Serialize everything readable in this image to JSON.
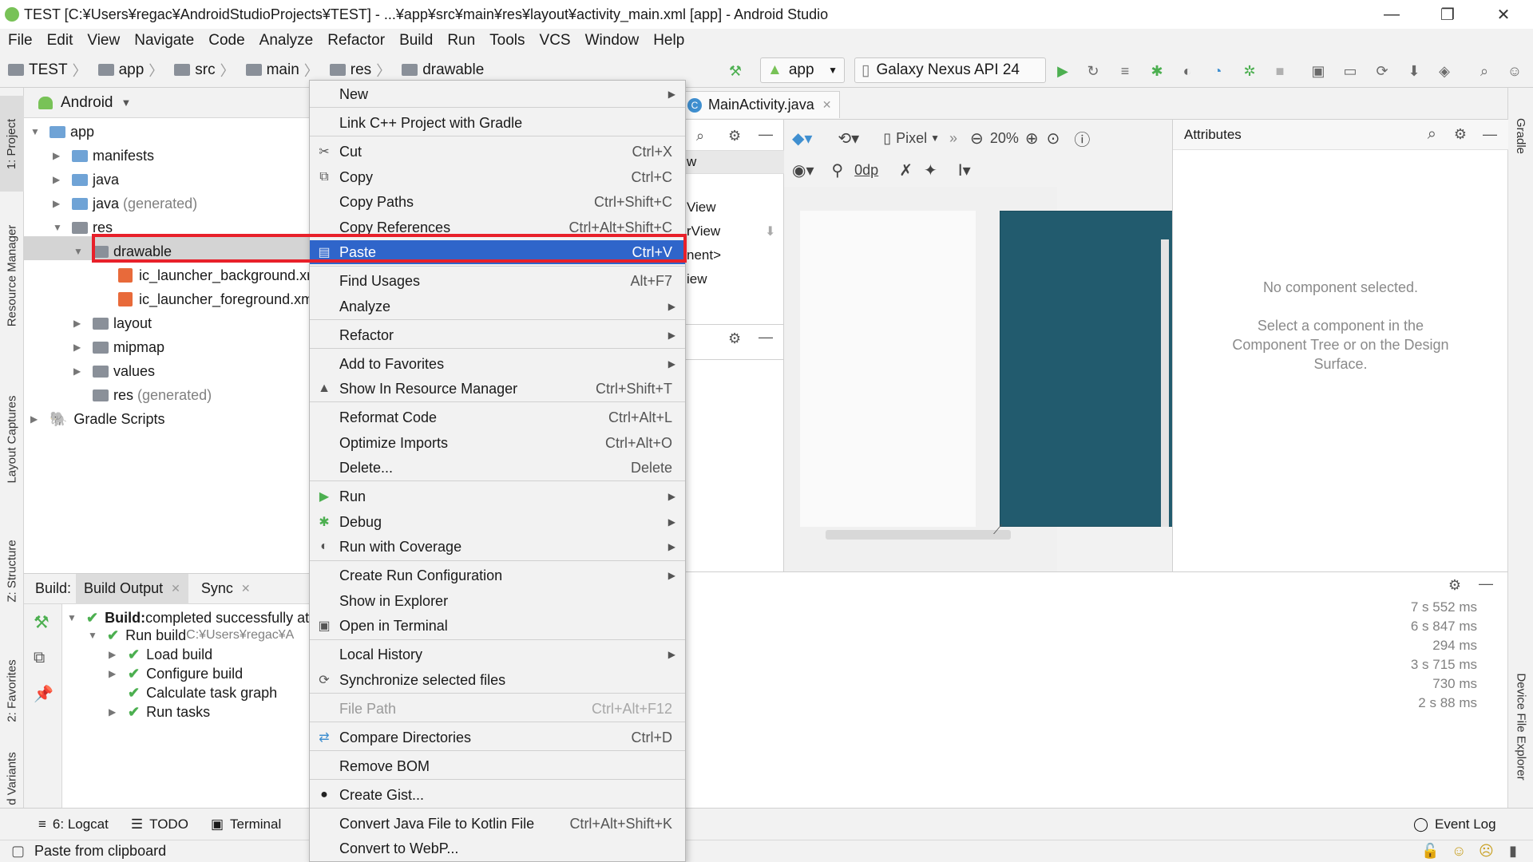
{
  "window": {
    "title": "TEST [C:¥Users¥regac¥AndroidStudioProjects¥TEST] - ...¥app¥src¥main¥res¥layout¥activity_main.xml [app] - Android Studio",
    "minimize": "—",
    "restore": "❐",
    "close": "✕"
  },
  "menubar": [
    "File",
    "Edit",
    "View",
    "Navigate",
    "Code",
    "Analyze",
    "Refactor",
    "Build",
    "Run",
    "Tools",
    "VCS",
    "Window",
    "Help"
  ],
  "breadcrumb": [
    "TEST",
    "app",
    "src",
    "main",
    "res",
    "drawable"
  ],
  "toolbar": {
    "config": "app",
    "device": "Galaxy Nexus API 24"
  },
  "left_stripe": [
    "1: Project",
    "Resource Manager",
    "Layout Captures",
    "Z: Structure",
    "2: Favorites",
    "d Variants"
  ],
  "right_stripe": [
    "Gradle",
    "Device File Explorer"
  ],
  "project": {
    "view": "Android",
    "tree": [
      {
        "label": "app",
        "extra": ""
      },
      {
        "label": "manifests",
        "extra": ""
      },
      {
        "label": "java",
        "extra": ""
      },
      {
        "label": "java",
        "extra": "(generated)"
      },
      {
        "label": "res",
        "extra": ""
      },
      {
        "label": "drawable",
        "extra": ""
      },
      {
        "label": "ic_launcher_background.xml",
        "extra": ""
      },
      {
        "label": "ic_launcher_foreground.xml",
        "extra": ""
      },
      {
        "label": "layout",
        "extra": ""
      },
      {
        "label": "mipmap",
        "extra": ""
      },
      {
        "label": "values",
        "extra": ""
      },
      {
        "label": "res",
        "extra": "(generated)"
      },
      {
        "label": "Gradle Scripts",
        "extra": ""
      }
    ]
  },
  "build": {
    "label": "Build:",
    "tabs": [
      "Build Output",
      "Sync"
    ],
    "rows": [
      {
        "bold": "Build:",
        "text": " completed successfully at"
      },
      {
        "bold": "",
        "text": "Run build",
        "path": " C:¥Users¥regac¥A"
      },
      {
        "bold": "",
        "text": "Load build"
      },
      {
        "bold": "",
        "text": "Configure build"
      },
      {
        "bold": "",
        "text": "Calculate task graph"
      },
      {
        "bold": "",
        "text": "Run tasks"
      }
    ],
    "times": [
      "7 s 552 ms",
      "6 s 847 ms",
      "294 ms",
      "3 s 715 ms",
      "730 ms",
      "2 s 88 ms"
    ]
  },
  "editor": {
    "tab": "MainActivity.java",
    "device": "Pixel",
    "zoom": "20%",
    "margin": "0dp",
    "palette_items": [
      "w",
      "View",
      "rView",
      "nent>",
      "iew"
    ]
  },
  "attributes": {
    "title": "Attributes",
    "empty_title": "No component selected.",
    "empty_hint": "Select a component in the Component Tree or on the Design Surface."
  },
  "context_menu": [
    {
      "label": "New",
      "shortcut": "",
      "submenu": true,
      "icon": "",
      "state": "normal"
    },
    {
      "label": "Link C++ Project with Gradle",
      "shortcut": "",
      "submenu": false,
      "icon": "",
      "state": "normal"
    },
    {
      "label": "Cut",
      "shortcut": "Ctrl+X",
      "submenu": false,
      "icon": "cut-icon",
      "state": "normal"
    },
    {
      "label": "Copy",
      "shortcut": "Ctrl+C",
      "submenu": false,
      "icon": "copy-icon",
      "state": "normal"
    },
    {
      "label": "Copy Paths",
      "shortcut": "Ctrl+Shift+C",
      "submenu": false,
      "icon": "",
      "state": "normal"
    },
    {
      "label": "Copy References",
      "shortcut": "Ctrl+Alt+Shift+C",
      "submenu": false,
      "icon": "",
      "state": "normal"
    },
    {
      "label": "Paste",
      "shortcut": "Ctrl+V",
      "submenu": false,
      "icon": "paste-icon",
      "state": "highlighted"
    },
    {
      "label": "Find Usages",
      "shortcut": "Alt+F7",
      "submenu": false,
      "icon": "",
      "state": "normal"
    },
    {
      "label": "Analyze",
      "shortcut": "",
      "submenu": true,
      "icon": "",
      "state": "normal"
    },
    {
      "label": "Refactor",
      "shortcut": "",
      "submenu": true,
      "icon": "",
      "state": "normal"
    },
    {
      "label": "Add to Favorites",
      "shortcut": "",
      "submenu": true,
      "icon": "",
      "state": "normal"
    },
    {
      "label": "Show In Resource Manager",
      "shortcut": "Ctrl+Shift+T",
      "submenu": false,
      "icon": "resource-manager-icon",
      "state": "normal"
    },
    {
      "label": "Reformat Code",
      "shortcut": "Ctrl+Alt+L",
      "submenu": false,
      "icon": "",
      "state": "normal"
    },
    {
      "label": "Optimize Imports",
      "shortcut": "Ctrl+Alt+O",
      "submenu": false,
      "icon": "",
      "state": "normal"
    },
    {
      "label": "Delete...",
      "shortcut": "Delete",
      "submenu": false,
      "icon": "",
      "state": "normal"
    },
    {
      "label": "Run",
      "shortcut": "",
      "submenu": true,
      "icon": "run-icon",
      "state": "normal"
    },
    {
      "label": "Debug",
      "shortcut": "",
      "submenu": true,
      "icon": "debug-icon",
      "state": "normal"
    },
    {
      "label": "Run with Coverage",
      "shortcut": "",
      "submenu": true,
      "icon": "coverage-icon",
      "state": "normal"
    },
    {
      "label": "Create Run Configuration",
      "shortcut": "",
      "submenu": true,
      "icon": "",
      "state": "normal"
    },
    {
      "label": "Show in Explorer",
      "shortcut": "",
      "submenu": false,
      "icon": "",
      "state": "normal"
    },
    {
      "label": "Open in Terminal",
      "shortcut": "",
      "submenu": false,
      "icon": "terminal-icon",
      "state": "normal"
    },
    {
      "label": "Local History",
      "shortcut": "",
      "submenu": true,
      "icon": "",
      "state": "normal"
    },
    {
      "label": "Synchronize selected files",
      "shortcut": "",
      "submenu": false,
      "icon": "sync-icon",
      "state": "normal"
    },
    {
      "label": "File Path",
      "shortcut": "Ctrl+Alt+F12",
      "submenu": false,
      "icon": "",
      "state": "disabled"
    },
    {
      "label": "Compare Directories",
      "shortcut": "Ctrl+D",
      "submenu": false,
      "icon": "compare-icon",
      "state": "normal"
    },
    {
      "label": "Remove BOM",
      "shortcut": "",
      "submenu": false,
      "icon": "",
      "state": "normal"
    },
    {
      "label": "Create Gist...",
      "shortcut": "",
      "submenu": false,
      "icon": "github-icon",
      "state": "normal"
    },
    {
      "label": "Convert Java File to Kotlin File",
      "shortcut": "Ctrl+Alt+Shift+K",
      "submenu": false,
      "icon": "",
      "state": "normal"
    },
    {
      "label": "Convert to WebP...",
      "shortcut": "",
      "submenu": false,
      "icon": "",
      "state": "normal"
    }
  ],
  "bottom_tabs": [
    "6: Logcat",
    "TODO",
    "Terminal"
  ],
  "event_log": "Event Log",
  "status": "Paste from clipboard",
  "colors": {
    "highlight": "#2f65ca",
    "annotation_box": "#e8202a",
    "design_surface": "#225b6e",
    "success": "#4caf50"
  }
}
